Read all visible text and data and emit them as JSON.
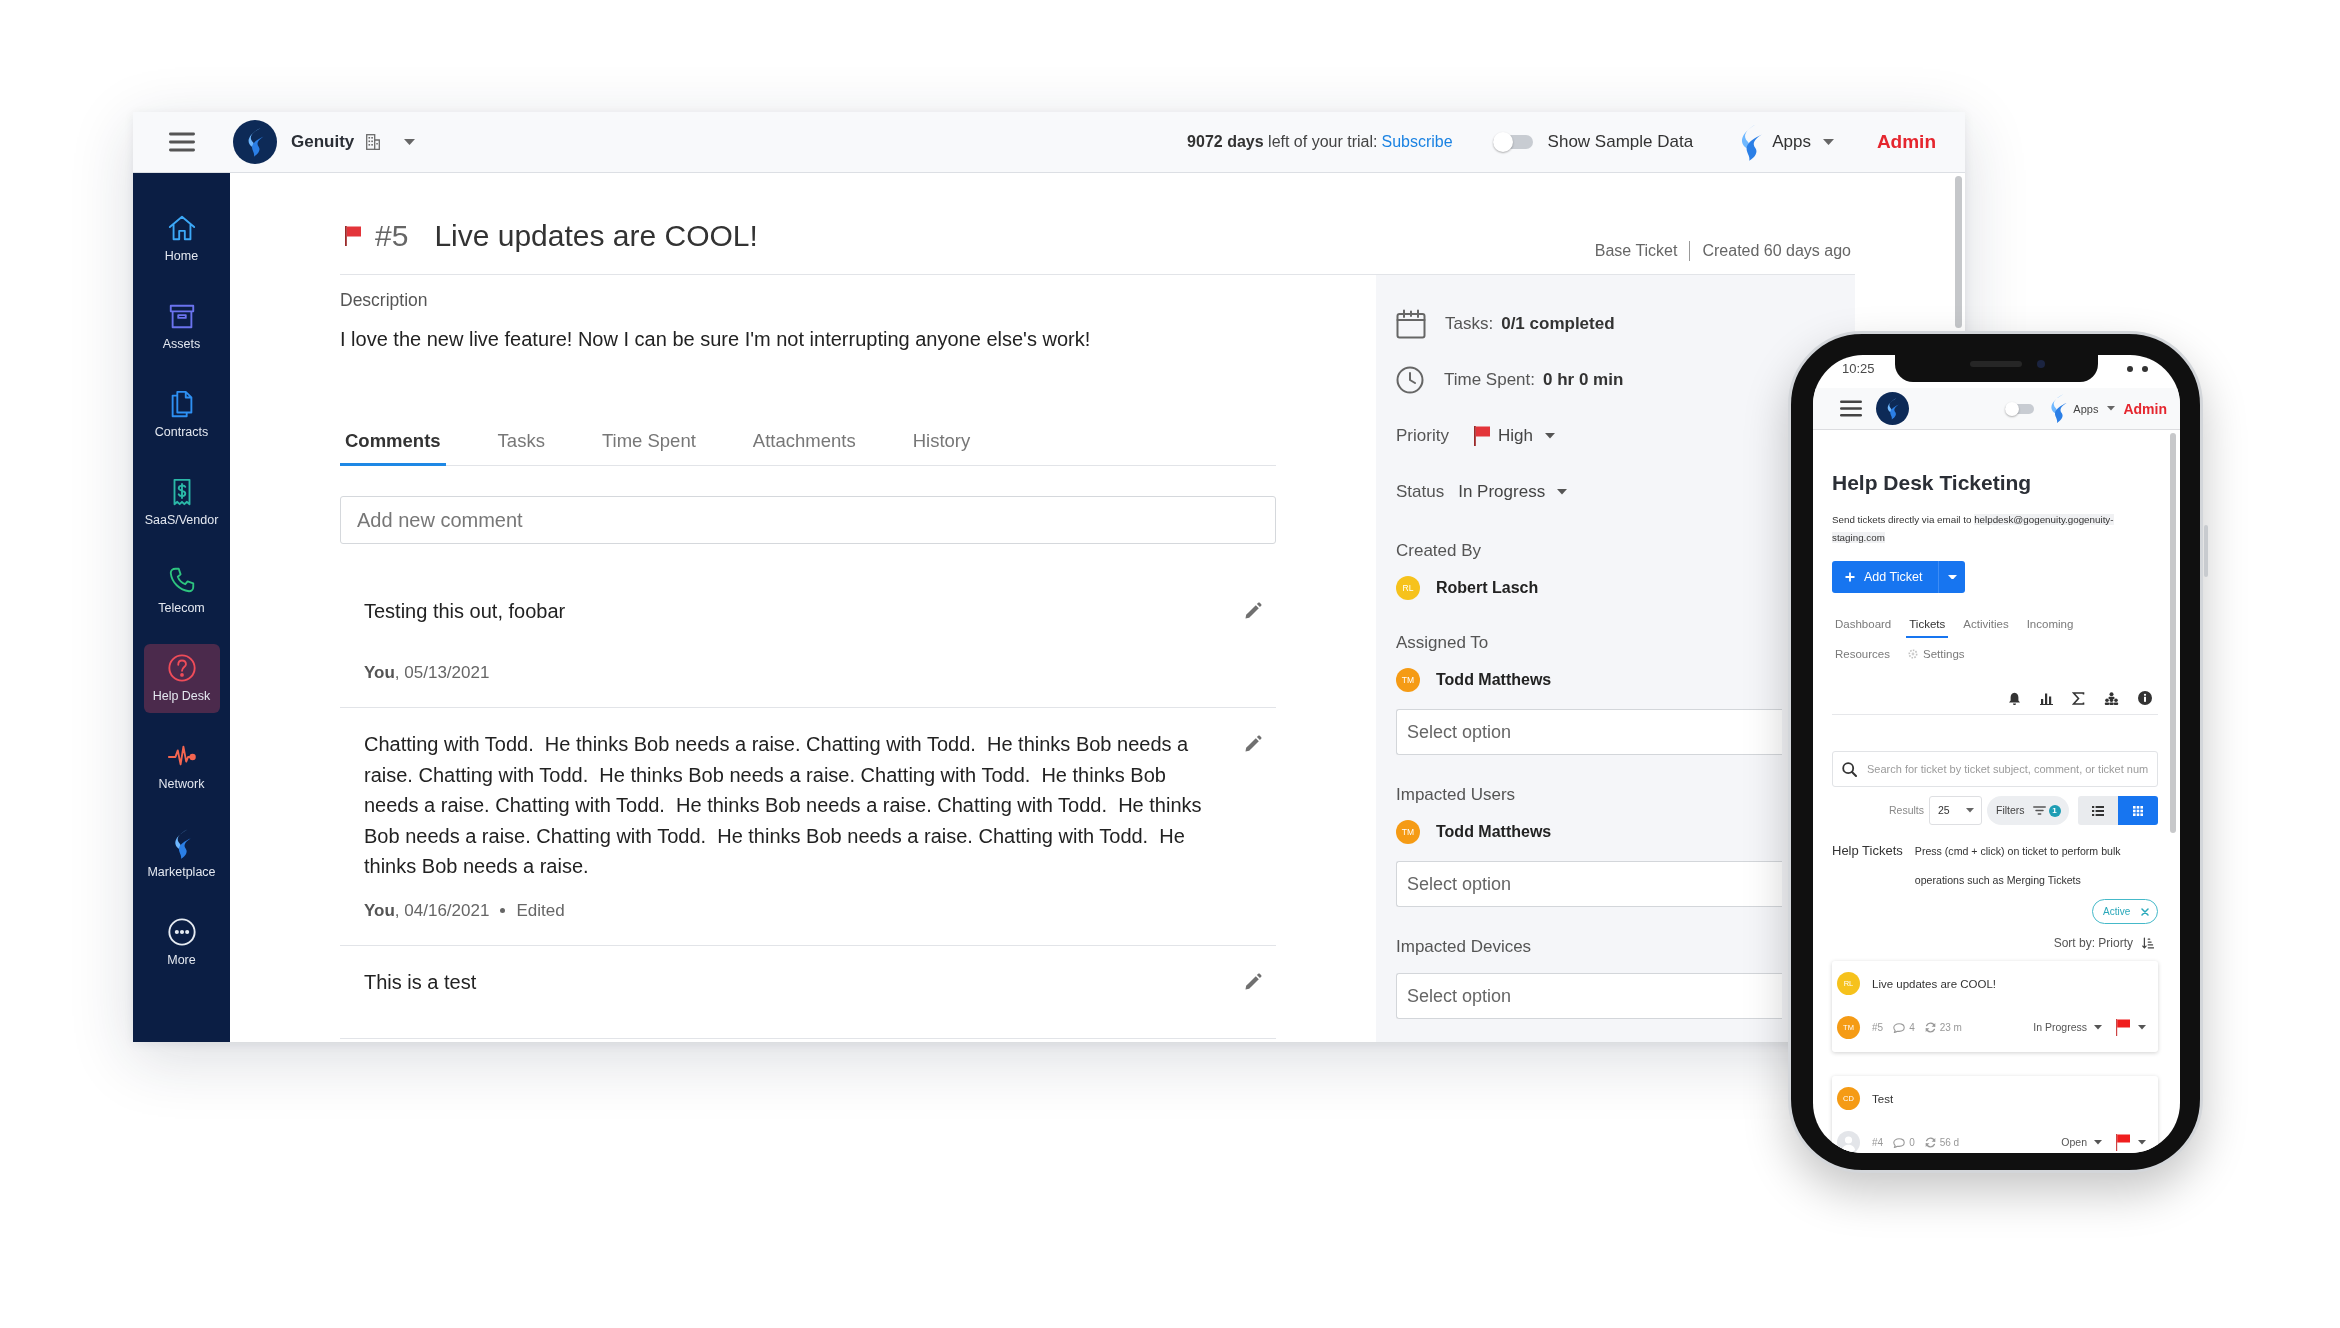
{
  "topbar": {
    "company": "Genuity",
    "trial": {
      "text": "**9072 days** left of your trial:",
      "link": "Subscribe"
    },
    "sample_data": {
      "label": "Show Sample Data",
      "on": false
    },
    "apps": "Apps",
    "role": "Admin"
  },
  "sidebar": {
    "items": [
      {
        "label": "Home",
        "selected": false
      },
      {
        "label": "Assets",
        "selected": false
      },
      {
        "label": "Contracts",
        "selected": false
      },
      {
        "label": "SaaS/Vendor",
        "selected": false
      },
      {
        "label": "Telecom",
        "selected": false
      },
      {
        "label": "Help Desk",
        "selected": true
      },
      {
        "label": "Network",
        "selected": false
      },
      {
        "label": "Marketplace",
        "selected": false
      },
      {
        "label": "More",
        "selected": false
      }
    ]
  },
  "ticket": {
    "number": "#5",
    "title": "Live updates are COOL!",
    "source": "Base Ticket",
    "created": "Created 60 days ago",
    "description_label": "Description",
    "description": "I love the new live feature! Now I can be sure I'm not interrupting anyone else's work!",
    "tabs": [
      {
        "label": "Comments",
        "selected": true
      },
      {
        "label": "Tasks",
        "selected": false
      },
      {
        "label": "Time Spent",
        "selected": false
      },
      {
        "label": "Attachments",
        "selected": false
      },
      {
        "label": "History",
        "selected": false
      }
    ],
    "comment_placeholder": "Add new comment",
    "comments": [
      {
        "text": "Testing this out, foobar",
        "meta": "**You**, 05/13/2021"
      },
      {
        "text": "Chatting with Todd.  He thinks Bob needs a raise. Chatting with Todd.  He thinks Bob needs a raise. Chatting with Todd.  He thinks Bob needs a raise. Chatting with Todd.  He thinks Bob needs a raise. Chatting with Todd.  He thinks Bob needs a raise. Chatting with Todd.  He thinks Bob needs a raise. Chatting with Todd.  He thinks Bob needs a raise. Chatting with Todd.  He thinks Bob needs a raise.",
        "meta": "**You**, 04/16/2021",
        "edited": "Edited"
      },
      {
        "text": "This is a test"
      }
    ]
  },
  "details": {
    "tasks": {
      "label": "Tasks:",
      "value": "0/1 completed"
    },
    "time_spent": {
      "label": "Time Spent:",
      "value": "0 hr 0 min"
    },
    "priority": {
      "label": "Priority",
      "value": "High"
    },
    "status": {
      "label": "Status",
      "value": "In Progress"
    },
    "fields": [
      {
        "label": "Created By",
        "people": [
          {
            "initials": "RL",
            "name": "Robert Lasch",
            "color": "#f6c21c"
          }
        ]
      },
      {
        "label": "Assigned To",
        "people": [
          {
            "initials": "TM",
            "name": "Todd Matthews",
            "color": "#f59b15"
          }
        ],
        "select_placeholder": "Select option"
      },
      {
        "label": "Impacted Users",
        "people": [
          {
            "initials": "TM",
            "name": "Todd Matthews",
            "color": "#f59b15"
          }
        ],
        "select_placeholder": "Select option"
      },
      {
        "label": "Impacted Devices",
        "select_placeholder": "Select option"
      }
    ]
  },
  "phone": {
    "time": "10:25",
    "header": {
      "sample_data_on": false,
      "apps": "Apps",
      "role": "Admin"
    },
    "title": "Help Desk Ticketing",
    "email_note": "Send tickets directly via email to",
    "email": "helpdesk@gogenuity.gogenuity-staging.com",
    "add_button": "Add Ticket",
    "tabs": [
      {
        "label": "Dashboard",
        "kind": "tab",
        "selected": false
      },
      {
        "label": "Tickets",
        "kind": "tab",
        "selected": true
      },
      {
        "label": "Activities",
        "kind": "tab",
        "selected": false
      },
      {
        "label": "Incoming",
        "kind": "tab",
        "selected": false
      },
      {
        "label": "Resources",
        "kind": "tab",
        "selected": false
      },
      {
        "label": "Settings",
        "kind": "settings",
        "selected": false
      }
    ],
    "search_placeholder": "Search for ticket by ticket subject, comment, or ticket num",
    "results_label": "Results",
    "results_value": "25",
    "filters_label": "Filters",
    "filters_count": "1",
    "views": [
      {
        "kind": "list",
        "selected": false
      },
      {
        "kind": "grid",
        "selected": true
      }
    ],
    "list_heading": "Help Tickets",
    "list_hint": "Press (cmd + click) on ticket to perform bulk operations such as Merging Tickets",
    "active_filter": "Active",
    "sort": "Sort by: Priorty",
    "tickets": [
      {
        "requester": {
          "initials": "RL",
          "color": "#f6c21c"
        },
        "title": "Live updates are COOL!",
        "assignee": {
          "initials": "TM",
          "color": "#f59b15"
        },
        "number": "#5",
        "comments": "4",
        "updated": "23 m",
        "status": "In Progress"
      },
      {
        "requester": {
          "initials": "CD",
          "color": "#f59b15"
        },
        "title": "Test",
        "number": "#4",
        "comments": "0",
        "updated": "56 d",
        "status": "Open"
      }
    ]
  }
}
